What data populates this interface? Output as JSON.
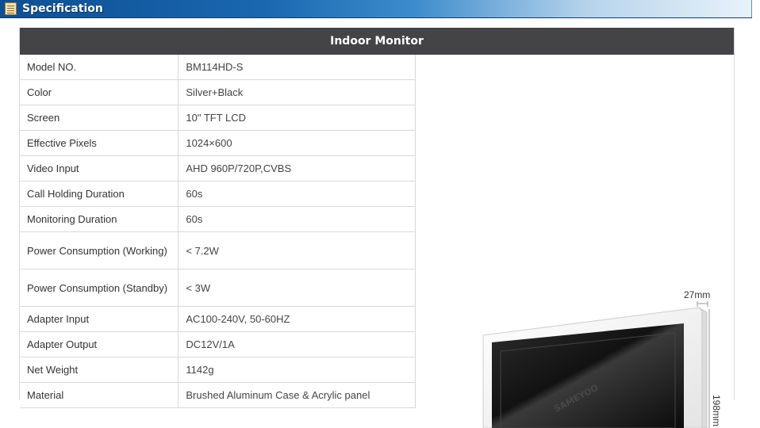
{
  "section": {
    "title": "Specification",
    "icon": "document-icon"
  },
  "panel": {
    "title": "Indoor Monitor"
  },
  "specs": [
    {
      "label": "Model NO.",
      "value": "BM114HD-S"
    },
    {
      "label": "Color",
      "value": "Silver+Black"
    },
    {
      "label": "Screen",
      "value": "10\" TFT LCD"
    },
    {
      "label": "Effective Pixels",
      "value": "1024×600"
    },
    {
      "label": "Video Input",
      "value": "AHD 960P/720P,CVBS"
    },
    {
      "label": "Call Holding Duration",
      "value": "60s"
    },
    {
      "label": "Monitoring Duration",
      "value": "60s"
    },
    {
      "label": "Power Consumption (Working)",
      "value": "< 7.2W"
    },
    {
      "label": "Power Consumption (Standby)",
      "value": "< 3W"
    },
    {
      "label": "Adapter Input",
      "value": "AC100-240V, 50-60HZ"
    },
    {
      "label": "Adapter Output",
      "value": "DC12V/1A"
    },
    {
      "label": "Net Weight",
      "value": "1142g"
    },
    {
      "label": "Material",
      "value": "Brushed Aluminum Case & Acrylic panel"
    }
  ],
  "product_image": {
    "depth_label": "27mm",
    "height_label": "198mm",
    "watermark": "SAMEYOO"
  }
}
